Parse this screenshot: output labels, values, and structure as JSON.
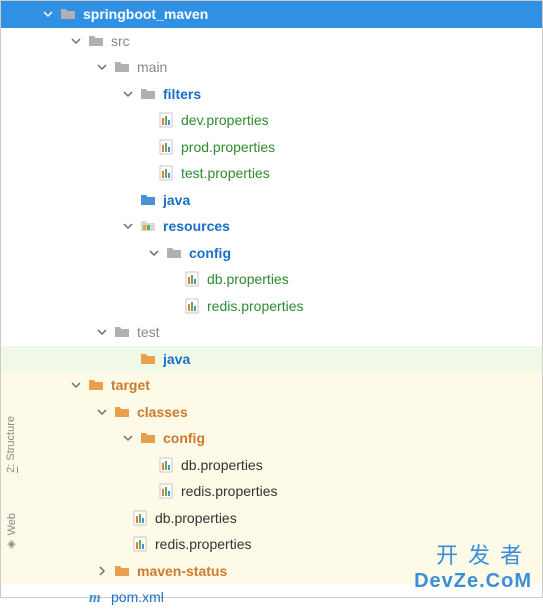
{
  "tree": {
    "root": {
      "label": "springboot_maven"
    },
    "src": {
      "label": "src"
    },
    "main": {
      "label": "main"
    },
    "filters": {
      "label": "filters"
    },
    "dev_properties": {
      "label": "dev.properties"
    },
    "prod_properties": {
      "label": "prod.properties"
    },
    "test_properties": {
      "label": "test.properties"
    },
    "java_main": {
      "label": "java"
    },
    "resources": {
      "label": "resources"
    },
    "config": {
      "label": "config"
    },
    "db_properties": {
      "label": "db.properties"
    },
    "redis_properties": {
      "label": "redis.properties"
    },
    "test": {
      "label": "test"
    },
    "java_test": {
      "label": "java"
    },
    "target": {
      "label": "target"
    },
    "classes": {
      "label": "classes"
    },
    "config_target": {
      "label": "config"
    },
    "db_properties_target_cfg": {
      "label": "db.properties"
    },
    "redis_properties_target_cfg": {
      "label": "redis.properties"
    },
    "db_properties_target": {
      "label": "db.properties"
    },
    "redis_properties_target": {
      "label": "redis.properties"
    },
    "maven_status": {
      "label": "maven-status"
    },
    "pom_xml": {
      "label": "pom.xml"
    }
  },
  "sidebar": {
    "structure": "Structure",
    "web": "Web"
  },
  "watermark": {
    "line1": "开发者",
    "line2": "DevZe.CoM"
  }
}
